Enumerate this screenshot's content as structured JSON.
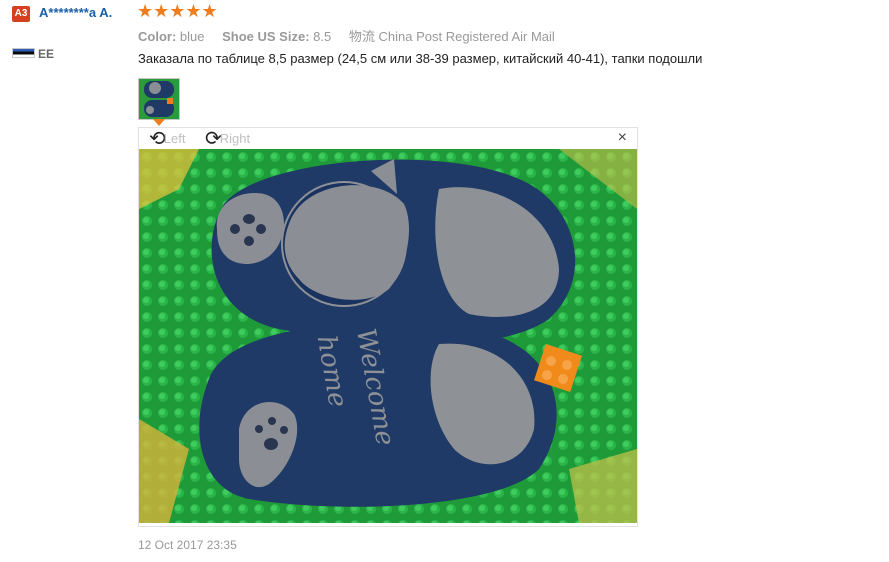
{
  "buyer": {
    "level_badge": "A3",
    "name": "A********a A.",
    "country": "EE"
  },
  "review": {
    "rating": 5,
    "stars": "★★★★★",
    "attributes": [
      {
        "label": "Color:",
        "value": "blue"
      },
      {
        "label": "Shoe US Size:",
        "value": "8.5"
      }
    ],
    "shipping": {
      "label": "物流",
      "value": "China Post Registered Air Mail"
    },
    "text": "Заказала по таблице 8,5 размер (24,5 см или 38-39 размер, китайский 40-41), тапки подошли",
    "date": "12 Oct 2017 23:35"
  },
  "viewer": {
    "rotate_left": "Left",
    "rotate_right": "Right",
    "close": "×",
    "slipper_text": [
      "Welcome",
      "home"
    ]
  },
  "colors": {
    "star": "#f07c1b",
    "name": "#1a5fa8",
    "badge": "#d7401f",
    "slipper": "#1f3a66",
    "mat": "#22a53d"
  },
  "icons": {
    "rotate_left": "rotate-left-icon",
    "rotate_right": "rotate-right-icon",
    "close": "close-icon",
    "flag": "estonia-flag-icon"
  }
}
